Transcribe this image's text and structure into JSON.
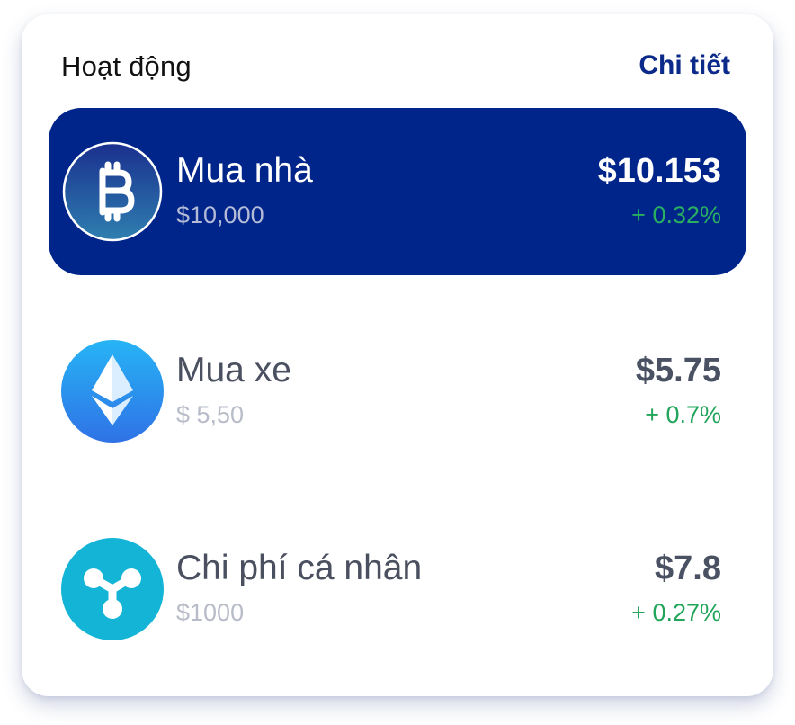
{
  "header": {
    "title": "Hoạt động",
    "link_label": "Chi tiết"
  },
  "colors": {
    "active_row_bg": "#00258a",
    "positive_change": "#21a55a",
    "link": "#0b2a8a"
  },
  "items": [
    {
      "name": "Mua nhà",
      "subtitle": "$10,000",
      "price": "$10.153",
      "change": "+ 0.32%",
      "icon": "bitcoin-icon",
      "active": true
    },
    {
      "name": "Mua xe",
      "subtitle": "$ 5,50",
      "price": "$5.75",
      "change": "+ 0.7%",
      "icon": "ethereum-icon",
      "active": false
    },
    {
      "name": "Chi phí cá nhân",
      "subtitle": "$1000",
      "price": "$7.8",
      "change": "+ 0.27%",
      "icon": "ripple-icon",
      "active": false
    }
  ]
}
